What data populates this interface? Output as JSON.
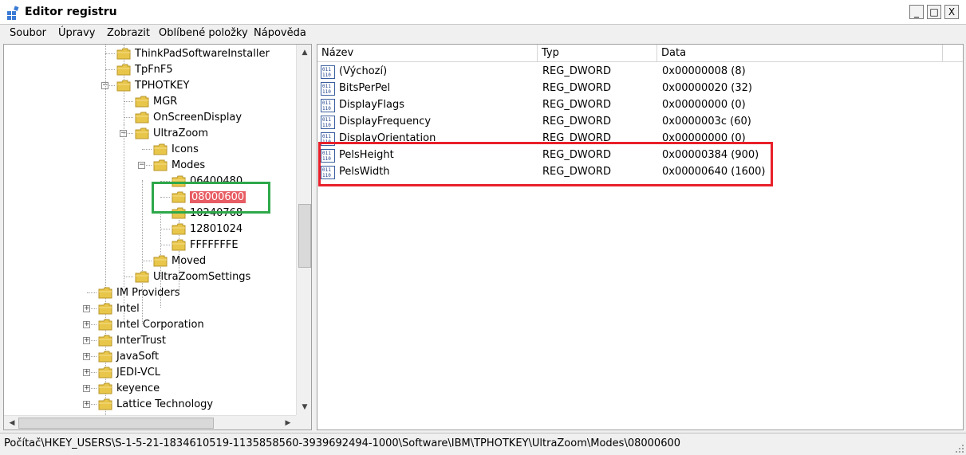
{
  "window": {
    "title": "Editor registru",
    "buttons": {
      "minimize": "_",
      "maximize": "□",
      "close": "X"
    }
  },
  "menu": [
    "Soubor",
    "Úpravy",
    "Zobrazit",
    "Oblíbené položky",
    "Nápověda"
  ],
  "tree": {
    "items": [
      {
        "label": "ThinkPadSoftwareInstaller",
        "level": 2,
        "expander": "none"
      },
      {
        "label": "TpFnF5",
        "level": 2,
        "expander": "none"
      },
      {
        "label": "TPHOTKEY",
        "level": 2,
        "expander": "minus"
      },
      {
        "label": "MGR",
        "level": 3,
        "expander": "none"
      },
      {
        "label": "OnScreenDisplay",
        "level": 3,
        "expander": "none"
      },
      {
        "label": "UltraZoom",
        "level": 3,
        "expander": "minus"
      },
      {
        "label": "Icons",
        "level": 4,
        "expander": "none"
      },
      {
        "label": "Modes",
        "level": 4,
        "expander": "minus"
      },
      {
        "label": "06400480",
        "level": 5,
        "expander": "none"
      },
      {
        "label": "08000600",
        "level": 5,
        "expander": "none",
        "selected": true
      },
      {
        "label": "10240768",
        "level": 5,
        "expander": "none"
      },
      {
        "label": "12801024",
        "level": 5,
        "expander": "none"
      },
      {
        "label": "FFFFFFFE",
        "level": 5,
        "expander": "none"
      },
      {
        "label": "Moved",
        "level": 4,
        "expander": "none"
      },
      {
        "label": "UltraZoomSettings",
        "level": 3,
        "expander": "none"
      },
      {
        "label": "IM Providers",
        "level": 1,
        "expander": "none"
      },
      {
        "label": "Intel",
        "level": 1,
        "expander": "plus"
      },
      {
        "label": "Intel Corporation",
        "level": 1,
        "expander": "plus"
      },
      {
        "label": "InterTrust",
        "level": 1,
        "expander": "plus"
      },
      {
        "label": "JavaSoft",
        "level": 1,
        "expander": "plus"
      },
      {
        "label": "JEDI-VCL",
        "level": 1,
        "expander": "plus"
      },
      {
        "label": "keyence",
        "level": 1,
        "expander": "plus"
      },
      {
        "label": "Lattice Technology",
        "level": 1,
        "expander": "plus"
      }
    ]
  },
  "list": {
    "columns": [
      "Název",
      "Typ",
      "Data"
    ],
    "rows": [
      {
        "name": "(Výchozí)",
        "type": "REG_DWORD",
        "data": "0x00000008 (8)"
      },
      {
        "name": "BitsPerPel",
        "type": "REG_DWORD",
        "data": "0x00000020 (32)"
      },
      {
        "name": "DisplayFlags",
        "type": "REG_DWORD",
        "data": "0x00000000 (0)"
      },
      {
        "name": "DisplayFrequency",
        "type": "REG_DWORD",
        "data": "0x0000003c (60)"
      },
      {
        "name": "DisplayOrientation",
        "type": "REG_DWORD",
        "data": "0x00000000 (0)"
      },
      {
        "name": "PelsHeight",
        "type": "REG_DWORD",
        "data": "0x00000384 (900)"
      },
      {
        "name": "PelsWidth",
        "type": "REG_DWORD",
        "data": "0x00000640 (1600)"
      }
    ]
  },
  "status": {
    "path": "Počítač\\HKEY_USERS\\S-1-5-21-1834610519-1135858560-3939692494-1000\\Software\\IBM\\TPHOTKEY\\UltraZoom\\Modes\\08000600"
  },
  "colors": {
    "selection": "#e85c63",
    "highlight_red": "#e8202a",
    "highlight_green": "#2ea84a",
    "folder": "#e8c64a"
  }
}
